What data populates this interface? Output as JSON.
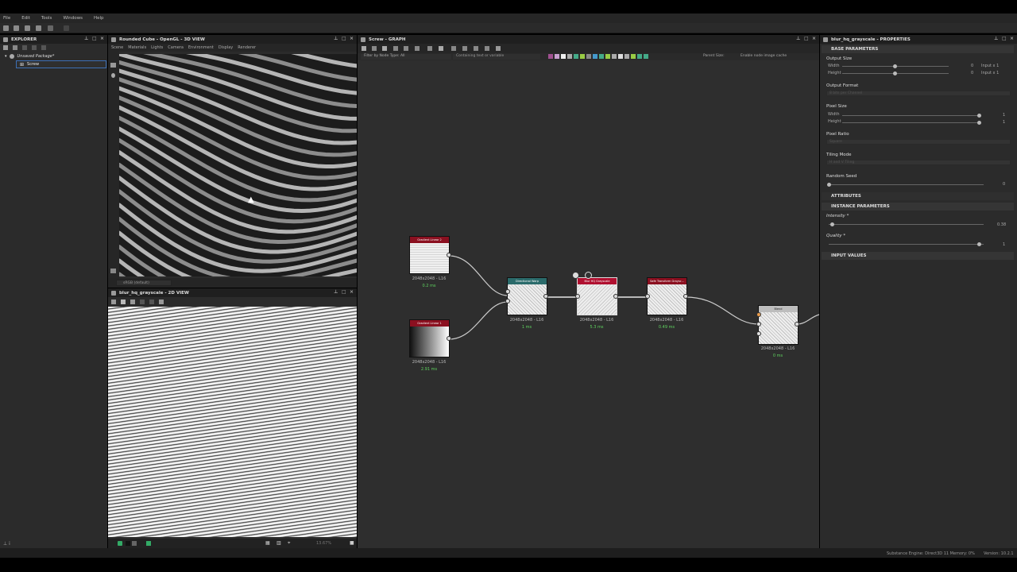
{
  "menu": [
    "File",
    "Edit",
    "Tools",
    "Windows",
    "Help"
  ],
  "explorer": {
    "title": "EXPLORER",
    "package": "Unsaved Package*",
    "graph_item": "Screw"
  },
  "view3d": {
    "title": "Rounded Cube - OpenGL - 3D VIEW",
    "menu": [
      "Scene",
      "Materials",
      "Lights",
      "Camera",
      "Environment",
      "Display",
      "Renderer"
    ],
    "colorspace": "sRGB (default)"
  },
  "view2d": {
    "title": "blur_hq_grayscale - 2D VIEW",
    "zoom": "13.67%"
  },
  "graph": {
    "title": "Screw - GRAPH",
    "filter_label": "Filter by Node Type: All",
    "search_placeholder": "Containing text or variable",
    "parent_size": "Parent Size:",
    "cache_label": "Enable node image cache",
    "nodes": [
      {
        "name": "Gradient Linear 2",
        "size": "2048x2048 - L16",
        "time": "0.2 ms",
        "color": "#8b1020"
      },
      {
        "name": "Gradient Linear 1",
        "size": "2048x2048 - L16",
        "time": "2.91 ms",
        "color": "#8b1020"
      },
      {
        "name": "Directional Warp",
        "size": "2048x2048 - L16",
        "time": "1 ms",
        "color": "#2b6b6b"
      },
      {
        "name": "Blur HQ Grayscale",
        "size": "2048x2048 - L16",
        "time": "5.3 ms",
        "color": "#b01030"
      },
      {
        "name": "Safe Transform Graysc...",
        "size": "2048x2048 - L16",
        "time": "0.49 ms",
        "color": "#8b1020"
      },
      {
        "name": "Blend",
        "size": "2048x2048 - L16",
        "time": "0 ms",
        "color": "#bdbdbd"
      }
    ]
  },
  "properties": {
    "title": "blur_hq_grayscale - PROPERTIES",
    "base_parameters": "BASE PARAMETERS",
    "output_size": "Output Size",
    "width": "Width",
    "height": "Height",
    "width_val": "0",
    "height_val": "0",
    "input_x1": "Input x 1",
    "input_x1b": "Input x 1",
    "output_format": "Output Format",
    "output_format_val": "8 bits per Channel",
    "pixel_size": "Pixel Size",
    "px_width": "Width",
    "px_height": "Height",
    "px_w_val": "1",
    "px_h_val": "1",
    "pixel_ratio": "Pixel Ratio",
    "pixel_ratio_val": "Square",
    "tiling_mode": "Tiling Mode",
    "tiling_val": "H and V Tiling",
    "random_seed": "Random Seed",
    "seed_val": "0",
    "attributes": "ATTRIBUTES",
    "instance_parameters": "INSTANCE PARAMETERS",
    "intensity": "Intensity *",
    "intensity_val": "0.38",
    "quality": "Quality *",
    "quality_val": "1",
    "input_values": "INPUT VALUES"
  },
  "status": {
    "engine": "Substance Engine: Direct3D 11  Memory: 0%",
    "version": "Version: 10.2.1"
  }
}
